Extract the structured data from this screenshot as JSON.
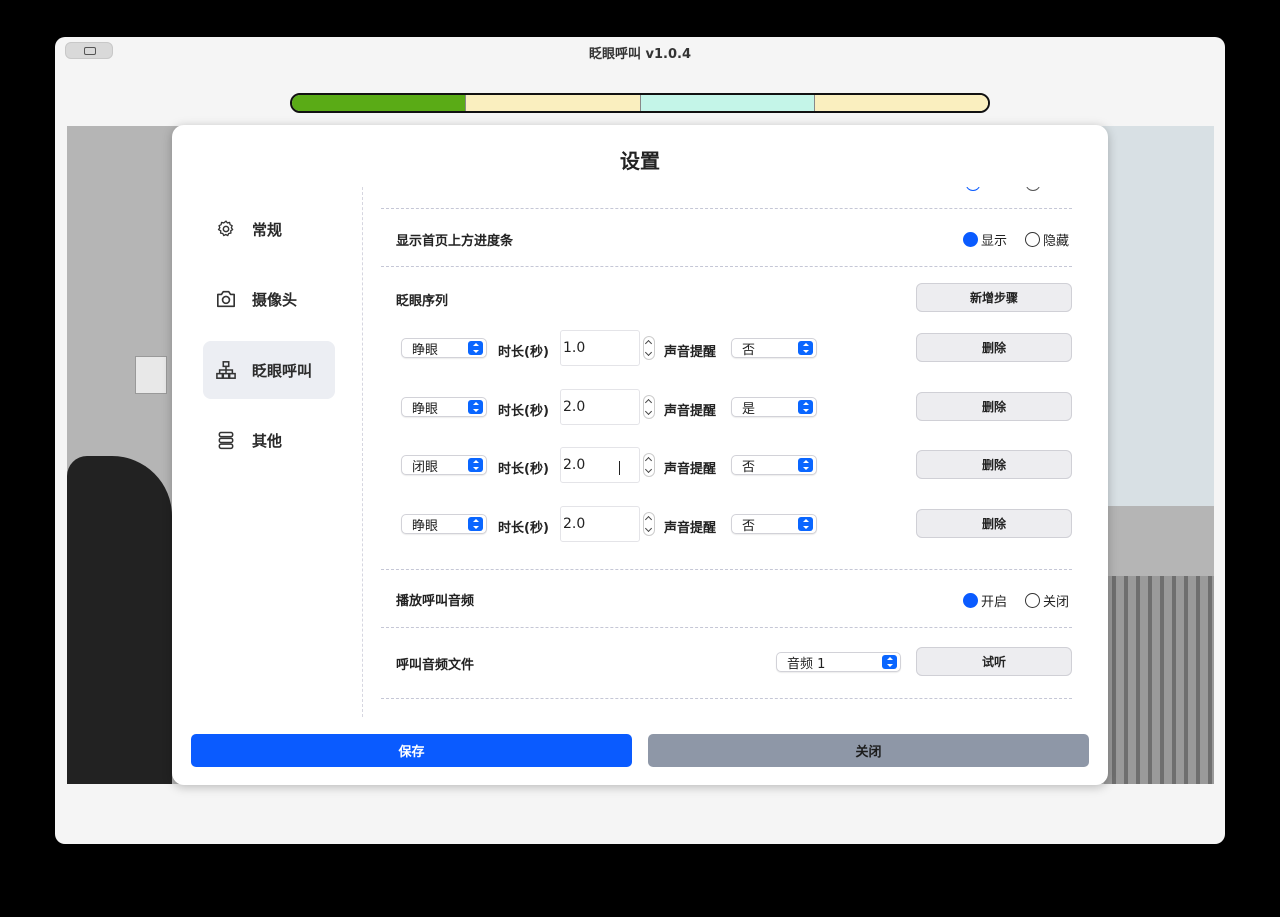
{
  "window": {
    "title": "眨眼呼叫 v1.0.4"
  },
  "progress": {
    "segments": [
      {
        "color": "#5aab16",
        "filled": true
      },
      {
        "color": "#faefbf",
        "filled": false
      },
      {
        "color": "#c4f5e8",
        "filled": false
      },
      {
        "color": "#faefbf",
        "filled": false
      }
    ]
  },
  "dialog": {
    "title": "设置",
    "sidebar": [
      {
        "label": "常规",
        "icon": "gear-icon",
        "active": false
      },
      {
        "label": "摄像头",
        "icon": "camera-icon",
        "active": false
      },
      {
        "label": "眨眼呼叫",
        "icon": "network-icon",
        "active": true
      },
      {
        "label": "其他",
        "icon": "stack-icon",
        "active": false
      }
    ],
    "show_progress": {
      "label": "显示首页上方进度条",
      "on_label": "显示",
      "off_label": "隐藏",
      "selected": "显示"
    },
    "blink_sequence": {
      "label": "眨眼序列",
      "add_button": "新增步骤",
      "duration_label": "时长(秒)",
      "sound_label": "声音提醒",
      "delete_label": "删除",
      "steps": [
        {
          "action": "睁眼",
          "duration": "1.0",
          "sound": "否"
        },
        {
          "action": "睁眼",
          "duration": "2.0",
          "sound": "是"
        },
        {
          "action": "闭眼",
          "duration": "2.0",
          "sound": "否"
        },
        {
          "action": "睁眼",
          "duration": "2.0",
          "sound": "否"
        }
      ]
    },
    "play_audio": {
      "label": "播放呼叫音频",
      "on_label": "开启",
      "off_label": "关闭",
      "selected": "开启"
    },
    "audio_file": {
      "label": "呼叫音频文件",
      "value": "音频 1",
      "preview_button": "试听"
    },
    "footer": {
      "save": "保存",
      "close": "关闭"
    }
  }
}
